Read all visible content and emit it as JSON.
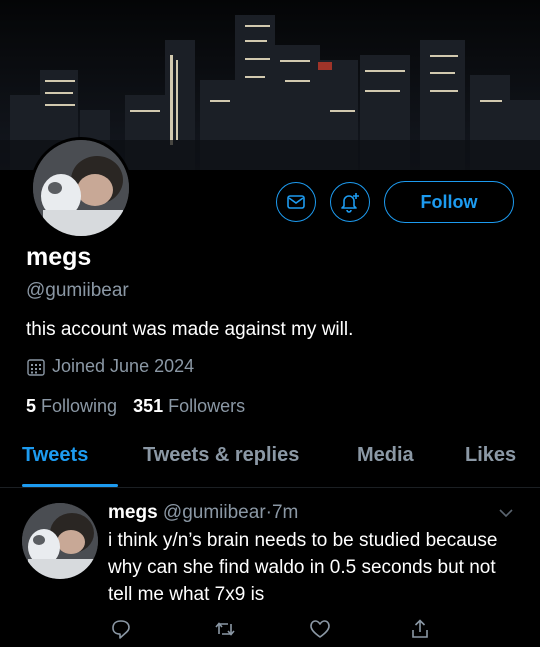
{
  "profile": {
    "name": "megs",
    "handle": "@gumiibear",
    "bio": "this account was made against my will.",
    "joined": "Joined June 2024",
    "following_count": "5",
    "following_label": "Following",
    "followers_count": "351",
    "followers_label": "Followers"
  },
  "actions": {
    "follow_label": "Follow",
    "message_icon": "envelope-icon",
    "notify_icon": "bell-plus-icon"
  },
  "tabs": [
    {
      "label": "Tweets",
      "active": true
    },
    {
      "label": "Tweets & replies",
      "active": false
    },
    {
      "label": "Media",
      "active": false
    },
    {
      "label": "Likes",
      "active": false
    }
  ],
  "tweet": {
    "name": "megs",
    "handle": "@gumiibear",
    "separator": "·",
    "time": "7m",
    "text": "i think y/n’s brain needs to be studied because why can she find waldo in 0.5 seconds but not tell me what 7x9 is",
    "action_icons": [
      "reply-icon",
      "retweet-icon",
      "like-icon",
      "share-icon"
    ]
  },
  "colors": {
    "accent": "#1d9bf0",
    "background": "#000000",
    "secondary_text": "#8b98a5",
    "primary_text": "#ffffff"
  }
}
